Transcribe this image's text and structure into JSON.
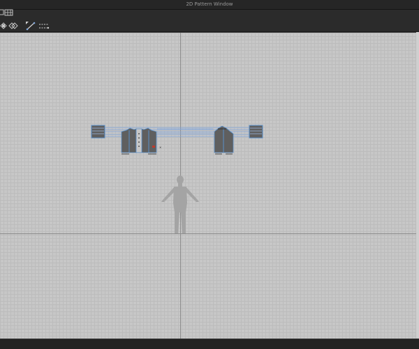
{
  "window": {
    "title": "2D Pattern Window"
  },
  "toolbar": {
    "tools": [
      {
        "name": "transform-pattern-tool",
        "icon": "grid-select-icon"
      },
      {
        "name": "edit-pattern-tool",
        "icon": "pattern-edit-icon"
      },
      {
        "name": "edit-points-tool",
        "icon": "points-edit-icon"
      },
      {
        "name": "segment-sewing-tool",
        "icon": "segment-sewing-icon"
      },
      {
        "name": "free-sewing-tool",
        "icon": "free-sewing-icon"
      }
    ]
  },
  "canvas": {
    "background": "#c7c7c7",
    "grid_color": "#bcbcbc",
    "axis_color": "#8d8d8d",
    "pattern_fill": "#5f5f5f",
    "pattern_outline": "#5a8fc8",
    "sewing_line": "#7fa6dd",
    "avatar_color": "#a4a4a4",
    "pieces": [
      {
        "name": "left-sleeve-piece"
      },
      {
        "name": "front-bodice-piece"
      },
      {
        "name": "back-bodice-piece"
      },
      {
        "name": "right-sleeve-piece"
      }
    ]
  },
  "statusbar": {
    "text": ""
  }
}
